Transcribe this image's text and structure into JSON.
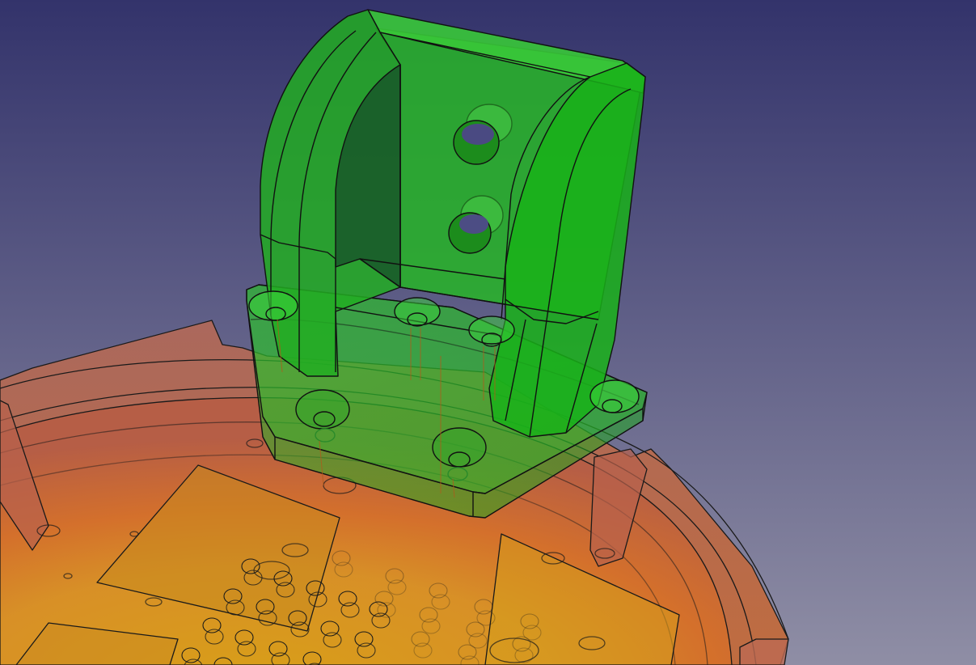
{
  "view": {
    "background_top": "#33336b",
    "background_bottom": "#8f8ea5",
    "outline_color": "#111111"
  },
  "bodies": [
    {
      "name": "bracket",
      "color": "#1fb81f"
    },
    {
      "name": "housing",
      "color": "#d67a32"
    }
  ]
}
